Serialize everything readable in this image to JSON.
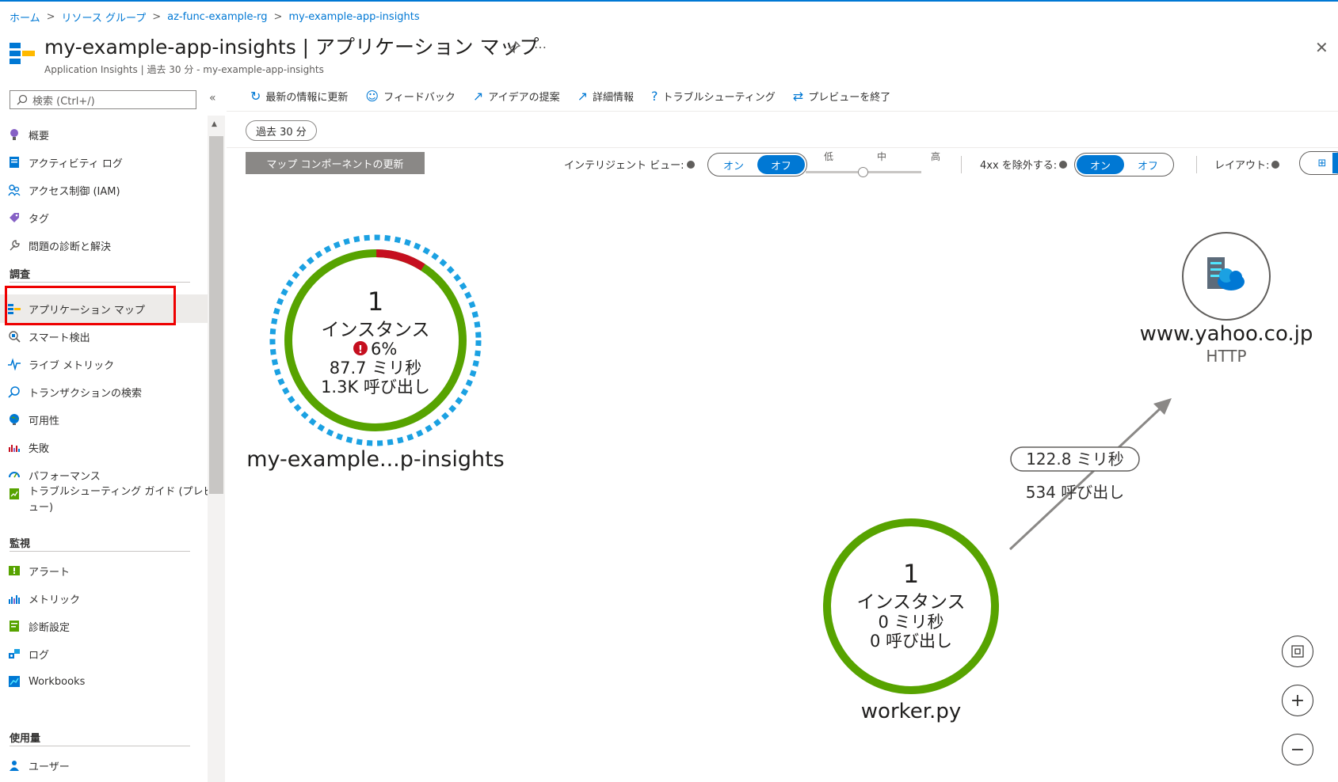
{
  "breadcrumb": [
    "ホーム",
    "リソース グループ",
    "az-func-example-rg",
    "my-example-app-insights"
  ],
  "header": {
    "title": "my-example-app-insights | アプリケーション マップ",
    "subtitle": "Application Insights | 過去 30 分 - my-example-app-insights",
    "more": "…",
    "close": "✕"
  },
  "sidebar": {
    "search_placeholder": "検索 (Ctrl+/)",
    "collapse": "«",
    "items": [
      {
        "label": "概要",
        "icon": "lightbulb-icon",
        "color": "#8661c5"
      },
      {
        "label": "アクティビティ ログ",
        "icon": "activity-log-icon",
        "color": "#0078d4"
      },
      {
        "label": "アクセス制御 (IAM)",
        "icon": "people-icon",
        "color": "#0078d4"
      },
      {
        "label": "タグ",
        "icon": "tag-icon",
        "color": "#8661c5"
      },
      {
        "label": "問題の診断と解決",
        "icon": "wrench-icon",
        "color": "#605e5c"
      }
    ],
    "section_investigate": "調査",
    "investigate_items": [
      {
        "label": "アプリケーション マップ",
        "icon": "app-map-icon",
        "active": true
      },
      {
        "label": "スマート検出",
        "icon": "smart-detection-icon"
      },
      {
        "label": "ライブ メトリック",
        "icon": "pulse-icon"
      },
      {
        "label": "トランザクションの検索",
        "icon": "search-icon"
      },
      {
        "label": "可用性",
        "icon": "globe-icon"
      },
      {
        "label": "失敗",
        "icon": "failures-chart-icon"
      },
      {
        "label": "パフォーマンス",
        "icon": "performance-icon"
      },
      {
        "label": "トラブルシューティング ガイド (プレビ",
        "label2": "ュー)",
        "icon": "troubleshoot-guide-icon"
      }
    ],
    "section_monitor": "監視",
    "monitor_items": [
      {
        "label": "アラート",
        "icon": "alert-icon"
      },
      {
        "label": "メトリック",
        "icon": "metrics-icon"
      },
      {
        "label": "診断設定",
        "icon": "diagnostic-settings-icon"
      },
      {
        "label": "ログ",
        "icon": "logs-icon"
      },
      {
        "label": "Workbooks",
        "icon": "workbooks-icon"
      }
    ],
    "section_usage": "使用量",
    "usage_items": [
      {
        "label": "ユーザー",
        "icon": "user-icon"
      }
    ]
  },
  "toolbar": {
    "refresh": "最新の情報に更新",
    "feedback": "フィードバック",
    "ideas": "アイデアの提案",
    "details": "詳細情報",
    "troubleshoot": "トラブルシューティング",
    "exit_preview": "プレビューを終了"
  },
  "time_range": "過去 30 分",
  "controls": {
    "update_button": "マップ コンポーネントの更新",
    "intelligent_view": "インテリジェント ビュー:",
    "on": "オン",
    "off": "オフ",
    "intelligent_view_state": "オフ",
    "sensitivity_low": "低",
    "sensitivity_mid": "中",
    "sensitivity_high": "高",
    "sensitivity_level": 0.5,
    "exclude_4xx": "4xx を除外する:",
    "exclude_4xx_state": "オン",
    "layout": "レイアウト:"
  },
  "map": {
    "node_app": {
      "count": "1",
      "instances": "インスタンス",
      "error_rate": "6%",
      "error_fraction": 0.06,
      "duration_value": "87.7",
      "duration_unit": " ミリ秒",
      "calls_value": "1.3K",
      "calls_unit": " 呼び出し",
      "name": "my-example...p-insights",
      "ring_color": "#57a300",
      "error_color": "#c50f1f",
      "dashed_color": "#1ba1e2"
    },
    "node_worker": {
      "count": "1",
      "instances": "インスタンス",
      "duration_value": "0",
      "duration_unit": " ミリ秒",
      "calls_value": "0",
      "calls_unit": " 呼び出し",
      "name": "worker.py",
      "ring_color": "#57a300"
    },
    "edge": {
      "duration": "122.8 ミリ秒",
      "calls": "534 呼び出し"
    },
    "node_external": {
      "name": "www.yahoo.co.jp",
      "type": "HTTP",
      "icon": "cloud-server-icon"
    }
  },
  "zoom_controls": {
    "fit": "fit-to-screen-icon",
    "zoom_in": "+",
    "zoom_out": "−"
  }
}
